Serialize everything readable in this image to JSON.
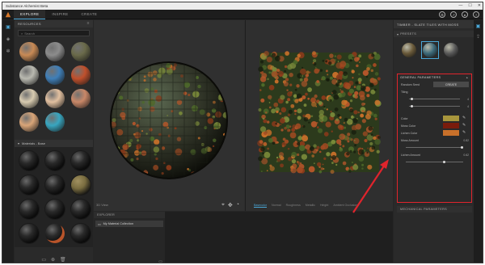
{
  "window": {
    "title": "Substance Alchemist Beta",
    "min": "—",
    "max": "☐",
    "close": "✕"
  },
  "menu": {
    "tabs": [
      "EXPLORE",
      "INSPIRE",
      "CREATE"
    ],
    "active": 0
  },
  "top_icons": [
    "gear-icon",
    "share-icon",
    "user-icon",
    "help-icon"
  ],
  "resources": {
    "title": "RESOURCES",
    "search_placeholder": "Search",
    "thumbs": [
      "#c88a55",
      "#8c8c8c",
      "#6a6a4a",
      "#b9b9b0",
      "#3f7fb8",
      "#c0502c",
      "#d8cbb0",
      "#e2c0a0",
      "#c98868",
      "#d9a578",
      "#38a6c0"
    ],
    "section_title": "Materials - Base",
    "dark_spheres": 12,
    "dark_special": [
      "#7a6d40",
      "#b8542a"
    ]
  },
  "viewport": {
    "label_3d": "3D View",
    "channels": [
      "Basecolor",
      "Normal",
      "Roughness",
      "Metallic",
      "Height",
      "Ambient Occlusion"
    ],
    "active_channel": 0
  },
  "bottom": {
    "header": "EXPLORER",
    "item": "My Material Collection"
  },
  "right": {
    "title": "TIMBER - SLATE TILES WITH MOSS",
    "presets_head": "PRESETS",
    "presets": [
      "#6a5a3a",
      "#3d6a7a",
      "#5a5a5a"
    ],
    "params_head": "GENERAL PARAMETERS",
    "random_seed_label": "Random Seed",
    "create_label": "CREATE",
    "tiling_label": "Tiling",
    "tiling_val_1": "4",
    "tiling_val_2": "4",
    "color_label": "Color",
    "color_hex": "#a8963c",
    "moss_label": "Moss Color",
    "moss_hex": "#7a1c0c",
    "lichen_label": "Lichen Color",
    "lichen_hex": "#c8702a",
    "moss_amount_label": "Moss Amount",
    "moss_amount_val": "0.82",
    "lichen_amount_label": "Lichen Amount",
    "lichen_amount_val": "0.62",
    "mech_head": "MECHANICAL PARAMETERS"
  }
}
